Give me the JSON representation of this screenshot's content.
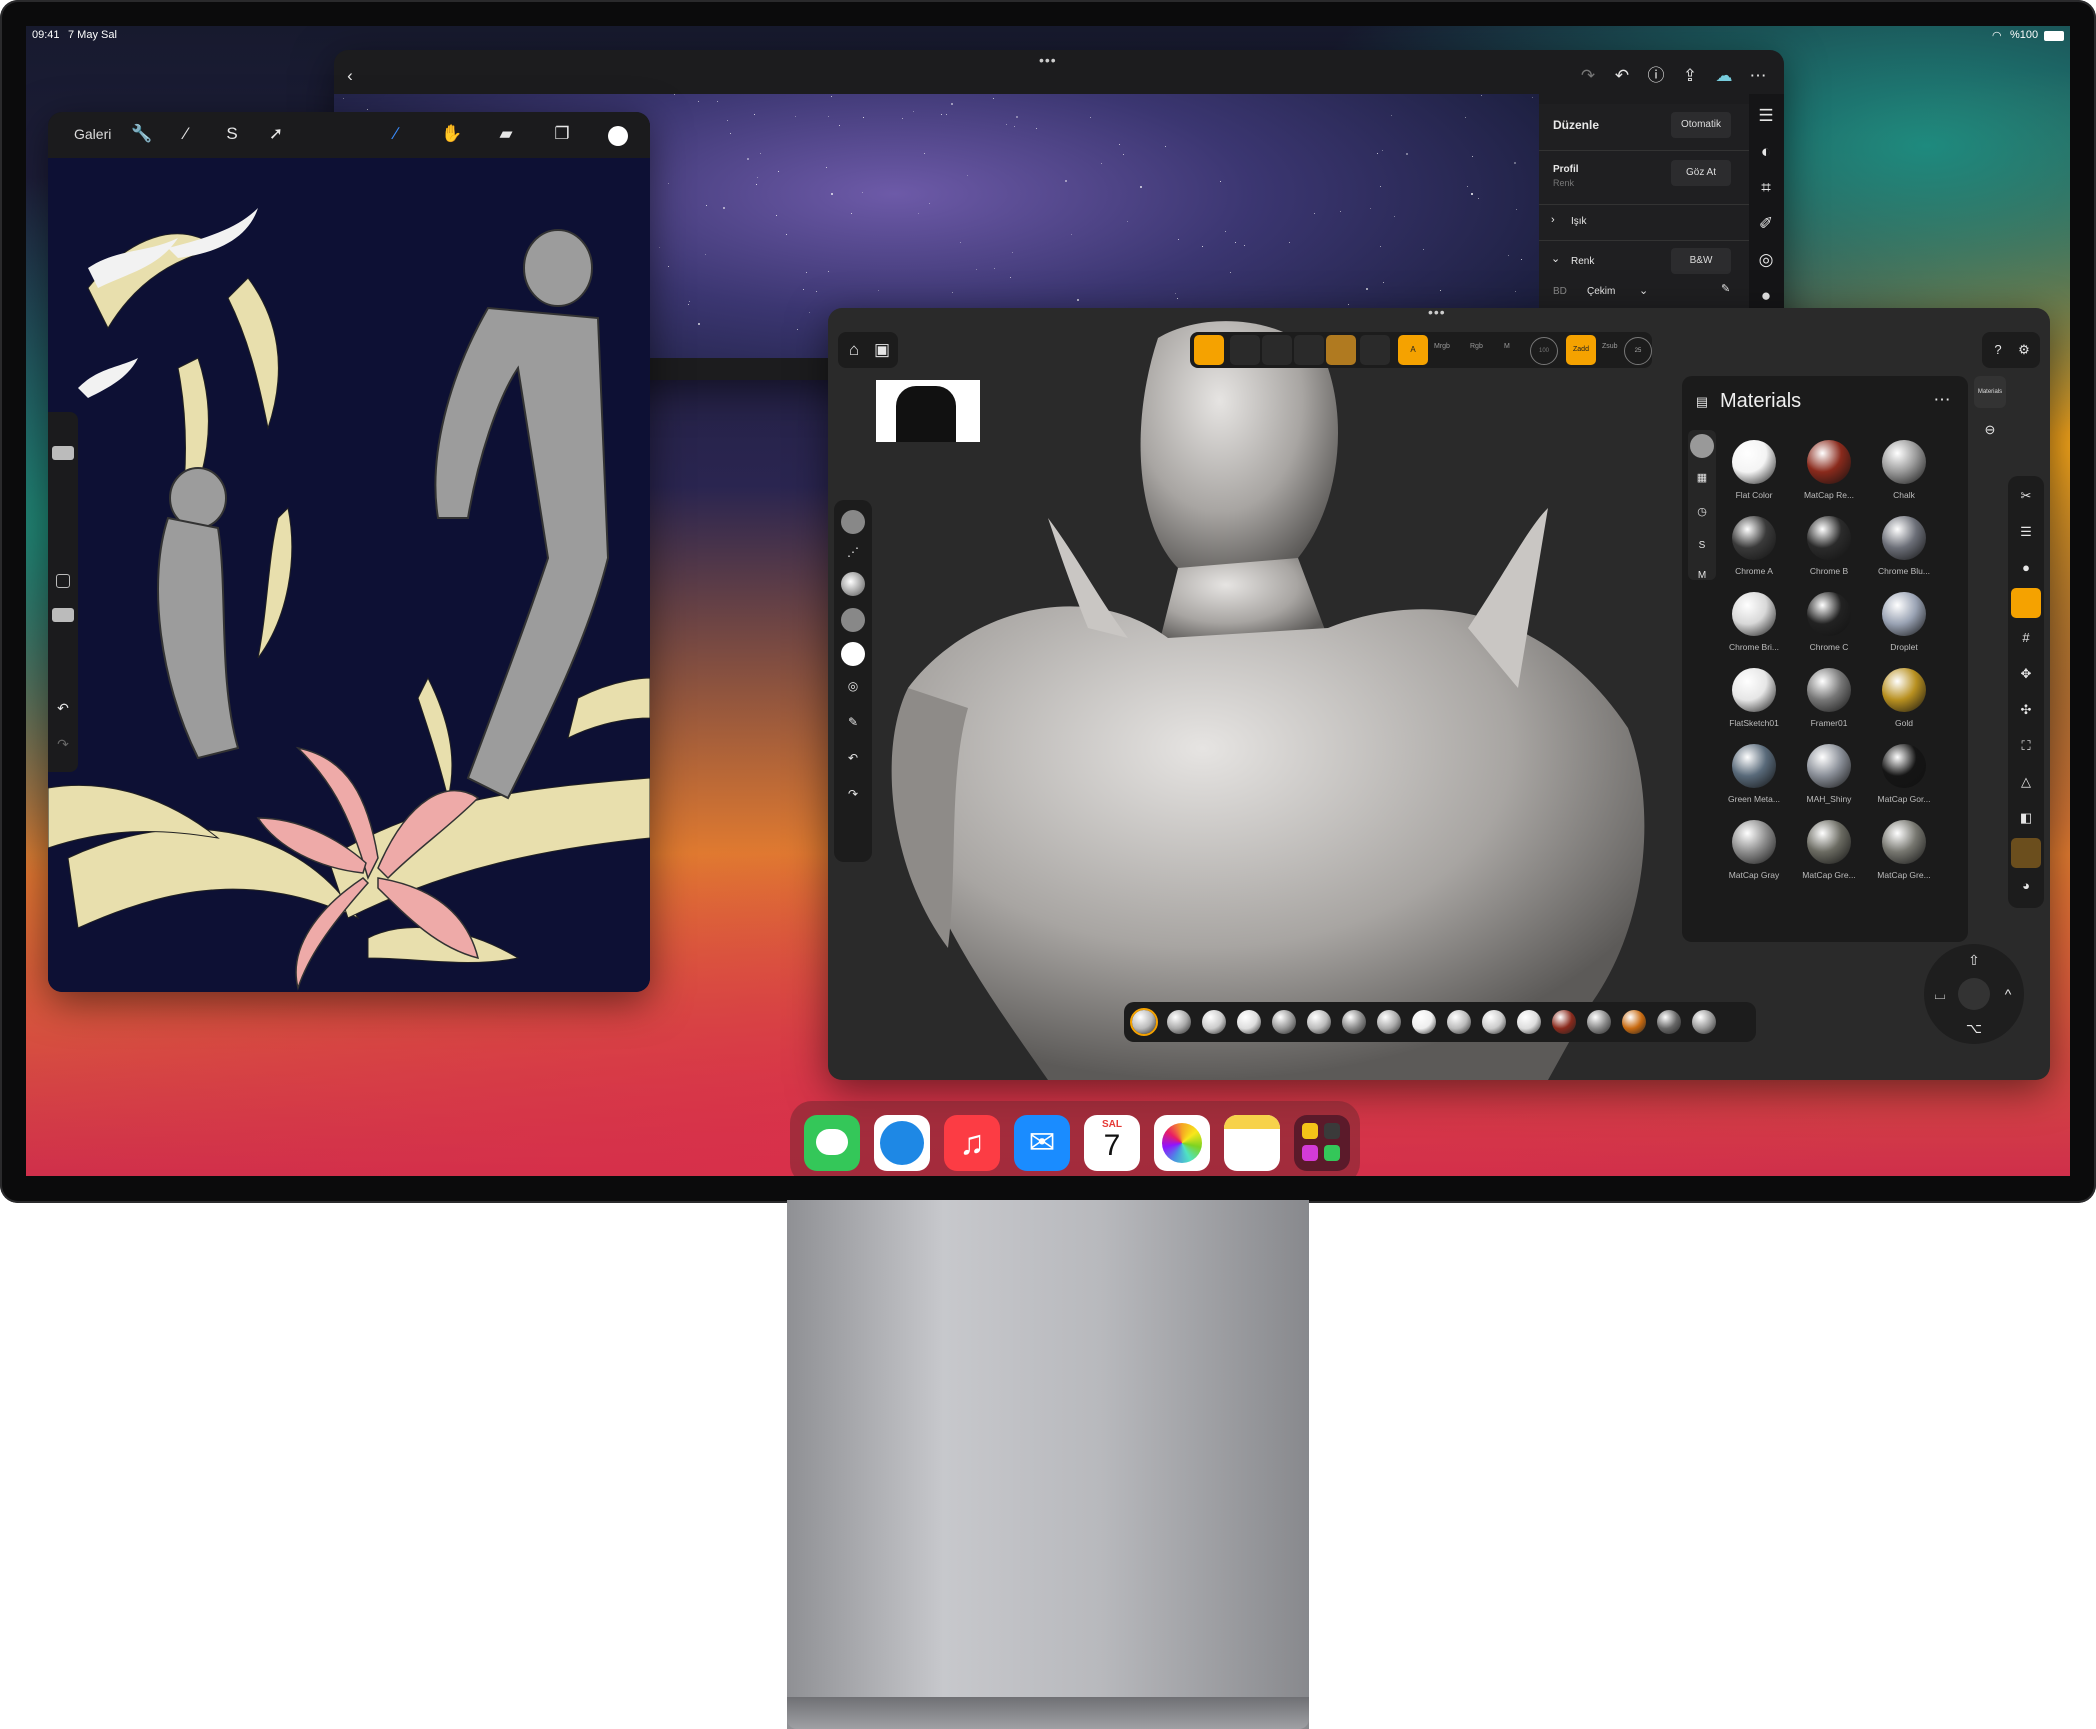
{
  "status": {
    "time": "09:41",
    "date": "7 May Sal",
    "battery": "%100"
  },
  "procreate": {
    "gallery_label": "Galeri",
    "toolbar_icons": [
      "wrench-icon",
      "magic-wand-icon",
      "selection-icon",
      "transform-arrow-icon"
    ],
    "tool_icons": [
      "brush-icon",
      "smudge-icon",
      "eraser-icon",
      "layers-icon",
      "color-icon"
    ]
  },
  "lightroom": {
    "panel_title": "Düzenle",
    "auto_button": "Otomatik",
    "profile_label": "Profil",
    "profile_value": "Renk",
    "browse_button": "Göz At",
    "light_section": "Işık",
    "color_section": "Renk",
    "bw_button": "B&W",
    "wb_label": "BD",
    "wb_value": "Çekim"
  },
  "nomad": {
    "materials_title": "Materials",
    "side_button": "Materials",
    "top_labels": [
      "A",
      "Mrgb",
      "Rgb",
      "M",
      "100",
      "Zadd",
      "Zsub",
      "25"
    ],
    "materials": [
      {
        "name": "Flat Color",
        "color": "#f4f4f4"
      },
      {
        "name": "MatCap Re...",
        "color": "#8a2a1c"
      },
      {
        "name": "Chalk",
        "color": "#9a9a9a"
      },
      {
        "name": "Chrome A",
        "color": "#3a3a3a"
      },
      {
        "name": "Chrome B",
        "color": "#2b2b2b"
      },
      {
        "name": "Chrome Blu...",
        "color": "#6c6f78"
      },
      {
        "name": "Chrome Bri...",
        "color": "#d8d8d8"
      },
      {
        "name": "Chrome C",
        "color": "#222222"
      },
      {
        "name": "Droplet",
        "color": "#9aa3b4"
      },
      {
        "name": "FlatSketch01",
        "color": "#e6e6e6"
      },
      {
        "name": "Framer01",
        "color": "#777777"
      },
      {
        "name": "Gold",
        "color": "#b89020"
      },
      {
        "name": "Green Meta...",
        "color": "#596a7a"
      },
      {
        "name": "MAH_Shiny",
        "color": "#8a8f98"
      },
      {
        "name": "MatCap Gor...",
        "color": "#151515"
      },
      {
        "name": "MatCap Gray",
        "color": "#8e8e8e"
      },
      {
        "name": "MatCap Gre...",
        "color": "#6b6b62"
      },
      {
        "name": "MatCap Gre...",
        "color": "#777770"
      }
    ]
  },
  "dock": {
    "apps": [
      {
        "name": "Messages",
        "icon": "messages-icon",
        "color": "#34c759"
      },
      {
        "name": "Safari",
        "icon": "safari-icon",
        "color": "#1e88e5"
      },
      {
        "name": "Music",
        "icon": "music-icon",
        "color": "#fc3c44"
      },
      {
        "name": "Mail",
        "icon": "mail-icon",
        "color": "#1a8cff"
      },
      {
        "name": "Calendar",
        "icon": "calendar-icon",
        "color": "#ffffff"
      },
      {
        "name": "Photos",
        "icon": "photos-icon",
        "color": "#ffffff"
      },
      {
        "name": "Notes",
        "icon": "notes-icon",
        "color": "#ffffff"
      },
      {
        "name": "App Library",
        "icon": "app-library-icon",
        "color": "#5b1a2a"
      }
    ],
    "calendar_day": "SAL",
    "calendar_date": "7"
  }
}
